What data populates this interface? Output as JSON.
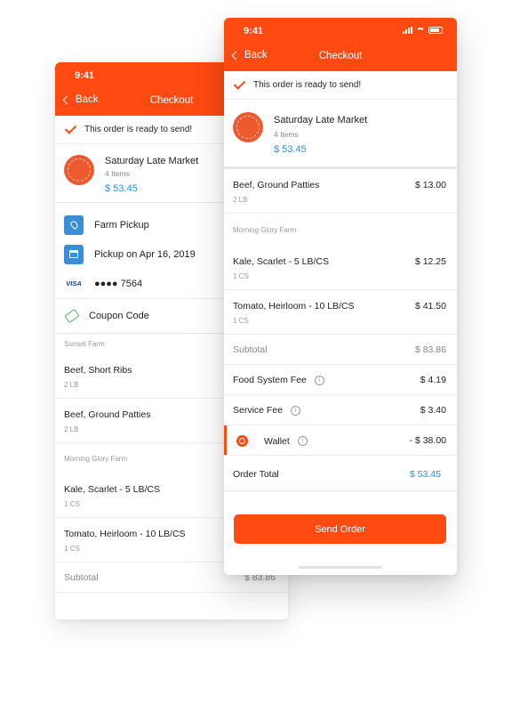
{
  "status": {
    "time": "9:41"
  },
  "nav": {
    "back_label": "Back",
    "title": "Checkout"
  },
  "ready_message": "This order is ready to send!",
  "market": {
    "name": "Saturday Late Market",
    "items": "4 Items",
    "total": "$ 53.45"
  },
  "delivery": {
    "method": "Farm Pickup",
    "pickup_date": "Pickup on Apr 16, 2019",
    "card_brand": "VISA",
    "card_number": "●●●● 7564",
    "coupon": "Coupon Code"
  },
  "sections": {
    "sunset": "Sunset Farm",
    "morning_glory": "Morning Glory Farm"
  },
  "items": [
    {
      "name": "Beef, Short Ribs",
      "qty": "2 LB",
      "price": ""
    },
    {
      "name": "Beef, Ground Patties",
      "qty": "2 LB",
      "price": "$ 13.00"
    },
    {
      "name": "Kale, Scarlet - 5 LB/CS",
      "qty": "1 CS",
      "price": "$ 12.25"
    },
    {
      "name": "Tomato, Heirloom - 10 LB/CS",
      "qty": "1 CS",
      "price": "$ 41.50"
    }
  ],
  "summary": {
    "subtotal_label": "Subtotal",
    "subtotal": "$ 83.86",
    "food_fee_label": "Food System Fee",
    "food_fee": "$ 4.19",
    "service_fee_label": "Service Fee",
    "service_fee": "$ 3.40",
    "wallet_label": "Wallet",
    "wallet": "- $ 38.00",
    "total_label": "Order Total",
    "total": "$ 53.45"
  },
  "info_glyph": "i",
  "send_label": "Send Order",
  "colors": {
    "brand": "#ff4a12",
    "link": "#2f8fd6",
    "icon_blue": "#3a8ed8",
    "coupon_green": "#52b26a"
  }
}
